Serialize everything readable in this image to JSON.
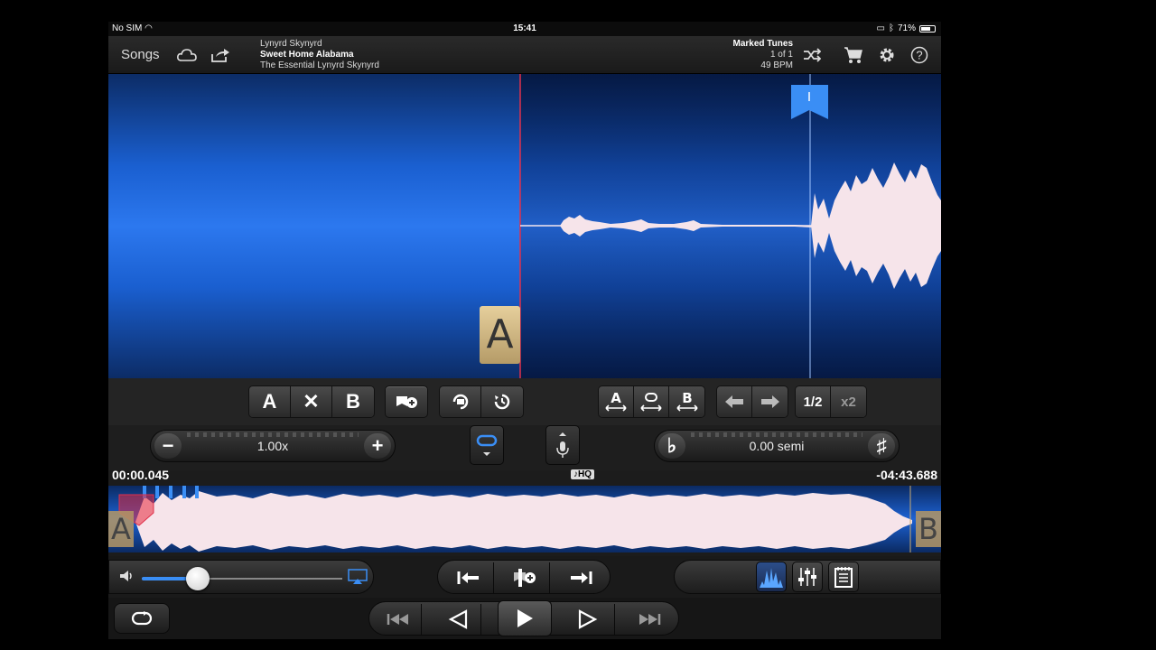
{
  "status_bar": {
    "carrier": "No SIM",
    "time": "15:41",
    "battery": "71%"
  },
  "nav": {
    "songs_label": "Songs",
    "artist": "Lynyrd Skynyrd",
    "title": "Sweet Home Alabama",
    "album": "The Essential Lynyrd Skynyrd",
    "marked_title": "Marked Tunes",
    "marked_count": "1 of 1",
    "bpm": "49 BPM",
    "icons": [
      "cloud-icon",
      "share-icon",
      "shuffle-icon",
      "cart-icon",
      "gear-icon",
      "help-icon"
    ]
  },
  "zoom": {
    "marker_a_label": "A"
  },
  "toolbar": {
    "a_label": "A",
    "clear_label": "✕",
    "b_label": "B",
    "half_label": "1/2",
    "x2_label": "x2"
  },
  "speed": {
    "value": "1.00x",
    "minus": "−",
    "plus": "+"
  },
  "pitch": {
    "value": "0.00 semi",
    "flat": "♭",
    "sharp": "♯"
  },
  "timeline": {
    "elapsed": "00:00.045",
    "remaining": "-04:43.688",
    "hq_label": "♪HQ"
  },
  "overview": {
    "a_label": "A",
    "b_label": "B"
  },
  "volume": {
    "level": 0.28
  },
  "colors": {
    "accent": "#3a8ef5",
    "marker": "#e6cf9c",
    "wave": "#f6e4ea"
  }
}
